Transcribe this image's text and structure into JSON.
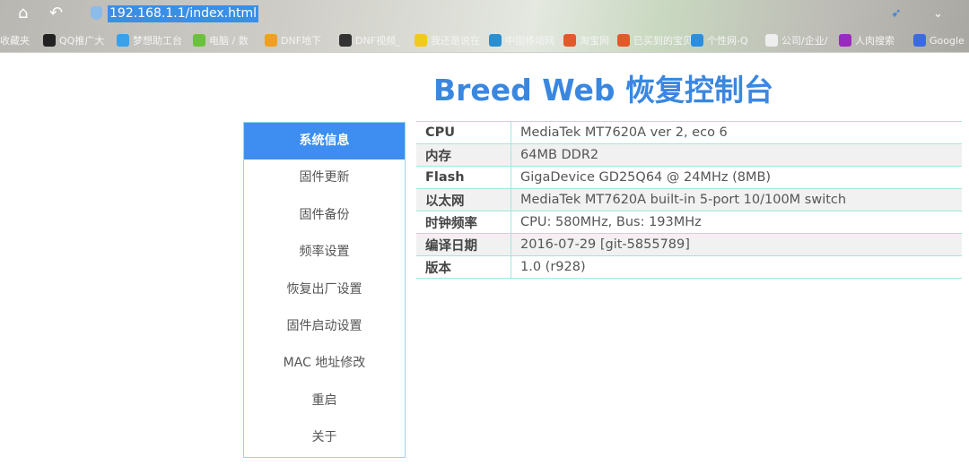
{
  "browser": {
    "url": "192.168.1.1/index.html",
    "bookmarks": [
      {
        "label": "收藏夹",
        "color": "transparent"
      },
      {
        "label": "QQ推广大",
        "color": "#222"
      },
      {
        "label": "梦想助工台",
        "color": "#3aa0e8"
      },
      {
        "label": "电脑 / 数",
        "color": "#6ac23c"
      },
      {
        "label": "DNF地下",
        "color": "#f0a020"
      },
      {
        "label": "DNF视频_",
        "color": "#333"
      },
      {
        "label": "我还是说在",
        "color": "#f3c820"
      },
      {
        "label": "中国移动网",
        "color": "#2a8fd0"
      },
      {
        "label": "淘宝网",
        "color": "#e25a2a"
      },
      {
        "label": "已买到的宝贝",
        "color": "#e25a2a"
      },
      {
        "label": "个性网-Q",
        "color": "#2a8fe0"
      },
      {
        "label": "公司/企业/",
        "color": "#eee"
      },
      {
        "label": "人肉搜索",
        "color": "#9a2ac0"
      },
      {
        "label": "Google",
        "color": "#3a6ae0"
      }
    ]
  },
  "page": {
    "title": "Breed Web 恢复控制台"
  },
  "sidebar": {
    "items": [
      "系统信息",
      "固件更新",
      "固件备份",
      "频率设置",
      "恢复出厂设置",
      "固件启动设置",
      "MAC 地址修改",
      "重启",
      "关于"
    ],
    "active": 0
  },
  "info": [
    {
      "k": "CPU",
      "v": "MediaTek MT7620A ver 2, eco 6"
    },
    {
      "k": "内存",
      "v": "64MB DDR2"
    },
    {
      "k": "Flash",
      "v": "GigaDevice GD25Q64 @ 24MHz (8MB)"
    },
    {
      "k": "以太网",
      "v": "MediaTek MT7620A built-in 5-port 10/100M switch"
    },
    {
      "k": "时钟频率",
      "v": "CPU: 580MHz, Bus: 193MHz"
    },
    {
      "k": "编译日期",
      "v": "2016-07-29 [git-5855789]"
    },
    {
      "k": "版本",
      "v": "1.0 (r928)"
    }
  ]
}
